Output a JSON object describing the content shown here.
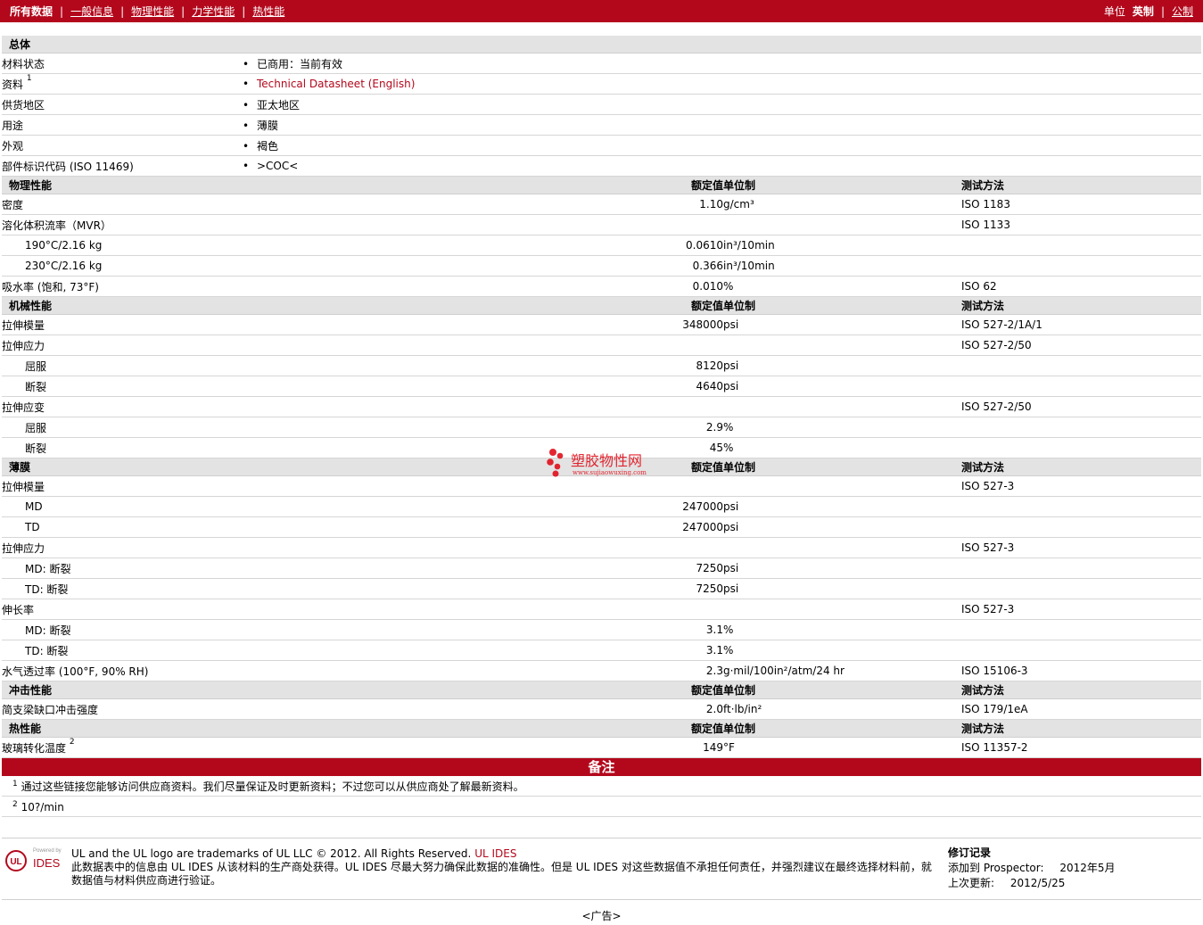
{
  "nav": {
    "all_data": "所有数据",
    "general": "一般信息",
    "physical": "物理性能",
    "mechanical": "力学性能",
    "thermal": "热性能",
    "unit_label": "单位",
    "english": "英制",
    "metric": "公制"
  },
  "headers": {
    "nominal": "额定值",
    "unit": "单位制",
    "method": "测试方法"
  },
  "general": {
    "title": "总体",
    "rows": [
      {
        "label": "材料状态",
        "value": "已商用：当前有效"
      },
      {
        "label": "资料",
        "sup": "1",
        "value": "Technical Datasheet (English)"
      },
      {
        "label": "供货地区",
        "value": "亚太地区"
      },
      {
        "label": "用途",
        "value": "薄膜"
      },
      {
        "label": "外观",
        "value": "褐色"
      },
      {
        "label": "部件标识代码 (ISO 11469)",
        "value": ">COC<"
      }
    ]
  },
  "physical": {
    "title": "物理性能",
    "rows": [
      {
        "label": "密度",
        "value": "1.10",
        "unit": "g/cm³",
        "method": "ISO 1183"
      },
      {
        "label": "溶化体积流率（MVR）",
        "value": "",
        "unit": "",
        "method": "ISO 1133"
      },
      {
        "label": "190°C/2.16 kg",
        "value": "0.0610",
        "unit": "in³/10min",
        "method": "",
        "indent": true
      },
      {
        "label": "230°C/2.16 kg",
        "value": "0.366",
        "unit": "in³/10min",
        "method": "",
        "indent": true
      },
      {
        "label": "吸水率 (饱和, 73°F)",
        "value": "0.010",
        "unit": "%",
        "method": "ISO 62"
      }
    ]
  },
  "mechanical": {
    "title": "机械性能",
    "rows": [
      {
        "label": "拉伸模量",
        "value": "348000",
        "unit": "psi",
        "method": "ISO 527-2/1A/1"
      },
      {
        "label": "拉伸应力",
        "value": "",
        "unit": "",
        "method": "ISO 527-2/50"
      },
      {
        "label": "屈服",
        "value": "8120",
        "unit": "psi",
        "method": "",
        "indent": true
      },
      {
        "label": "断裂",
        "value": "4640",
        "unit": "psi",
        "method": "",
        "indent": true
      },
      {
        "label": "拉伸应变",
        "value": "",
        "unit": "",
        "method": "ISO 527-2/50"
      },
      {
        "label": "屈服",
        "value": "2.9",
        "unit": "%",
        "method": "",
        "indent": true
      },
      {
        "label": "断裂",
        "value": "45",
        "unit": "%",
        "method": "",
        "indent": true
      }
    ]
  },
  "film": {
    "title": "薄膜",
    "rows": [
      {
        "label": "拉伸模量",
        "value": "",
        "unit": "",
        "method": "ISO 527-3"
      },
      {
        "label": "MD",
        "value": "247000",
        "unit": "psi",
        "method": "",
        "indent": true
      },
      {
        "label": "TD",
        "value": "247000",
        "unit": "psi",
        "method": "",
        "indent": true
      },
      {
        "label": "拉伸应力",
        "value": "",
        "unit": "",
        "method": "ISO 527-3"
      },
      {
        "label": "MD: 断裂",
        "value": "7250",
        "unit": "psi",
        "method": "",
        "indent": true
      },
      {
        "label": "TD: 断裂",
        "value": "7250",
        "unit": "psi",
        "method": "",
        "indent": true
      },
      {
        "label": "伸长率",
        "value": "",
        "unit": "",
        "method": "ISO 527-3"
      },
      {
        "label": "MD: 断裂",
        "value": "3.1",
        "unit": "%",
        "method": "",
        "indent": true
      },
      {
        "label": "TD: 断裂",
        "value": "3.1",
        "unit": "%",
        "method": "",
        "indent": true
      },
      {
        "label": "水气透过率 (100°F, 90% RH)",
        "value": "2.3",
        "unit": "g·mil/100in²/atm/24 hr",
        "method": "ISO 15106-3"
      }
    ]
  },
  "impact": {
    "title": "冲击性能",
    "rows": [
      {
        "label": "简支梁缺口冲击强度",
        "value": "2.0",
        "unit": "ft·lb/in²",
        "method": "ISO 179/1eA"
      }
    ]
  },
  "thermal": {
    "title": "热性能",
    "rows": [
      {
        "label": "玻璃转化温度",
        "sup": "2",
        "value": "149",
        "unit": "°F",
        "method": "ISO 11357-2"
      }
    ]
  },
  "notes": {
    "title": "备注",
    "items": [
      {
        "num": "1",
        "text": "通过这些链接您能够访问供应商资料。我们尽量保证及时更新资料；不过您可以从供应商处了解最新资料。"
      },
      {
        "num": "2",
        "text": "10?/min"
      }
    ]
  },
  "footer": {
    "logo_small": "Powered by",
    "logo_ul": "UL",
    "logo_ides": "IDES",
    "trademark": "UL and the UL logo are trademarks of UL LLC © 2012. All Rights Reserved.",
    "ul_ides_link": "UL IDES",
    "disclaimer": "此数据表中的信息由 UL IDES 从该材料的生产商处获得。UL IDES 尽最大努力确保此数据的准确性。但是 UL IDES 对这些数据值不承担任何责任，并强烈建议在最终选择材料前，就数据值与材料供应商进行验证。",
    "rev_title": "修订记录",
    "added_label": "添加到 Prospector:",
    "added_value": "2012年5月",
    "updated_label": "上次更新:",
    "updated_value": "2012/5/25",
    "ad": "<广告>"
  },
  "watermark": {
    "cn": "塑胶物性网",
    "url": "www.sujiaowuxing.com"
  }
}
